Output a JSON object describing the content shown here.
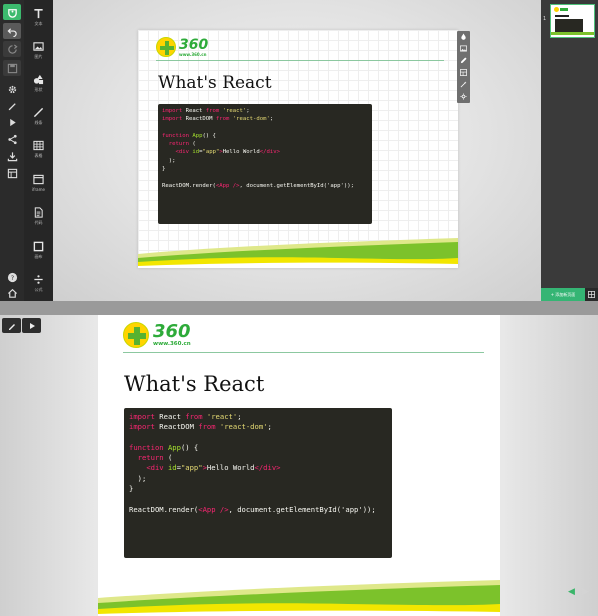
{
  "left_rail": {
    "items": [
      "home-logo",
      "undo",
      "redo",
      "save",
      "settings",
      "pen",
      "play",
      "share",
      "download",
      "template"
    ],
    "bottom": [
      "help",
      "home"
    ]
  },
  "tools": [
    {
      "name": "text",
      "label": "文本"
    },
    {
      "name": "image",
      "label": "图片"
    },
    {
      "name": "shape",
      "label": "形状"
    },
    {
      "name": "line",
      "label": "线条"
    },
    {
      "name": "table",
      "label": "表格"
    },
    {
      "name": "iframe",
      "label": "iframe"
    },
    {
      "name": "code",
      "label": "代码"
    },
    {
      "name": "canvas",
      "label": "画布"
    },
    {
      "name": "formula",
      "label": "公式"
    }
  ],
  "slide": {
    "logo_number": "360",
    "logo_url": "www.360.cn",
    "title": "What's React",
    "code_lines": [
      [
        [
          "kw",
          "import"
        ],
        [
          "plain",
          " React "
        ],
        [
          "kw",
          "from"
        ],
        [
          "plain",
          " "
        ],
        [
          "str",
          "'react'"
        ],
        [
          "plain",
          ";"
        ]
      ],
      [
        [
          "kw",
          "import"
        ],
        [
          "plain",
          " ReactDOM "
        ],
        [
          "kw",
          "from"
        ],
        [
          "plain",
          " "
        ],
        [
          "str",
          "'react-dom'"
        ],
        [
          "plain",
          ";"
        ]
      ],
      [
        [
          "plain",
          ""
        ]
      ],
      [
        [
          "kw",
          "function"
        ],
        [
          "plain",
          " "
        ],
        [
          "fn",
          "App"
        ],
        [
          "plain",
          "() {"
        ]
      ],
      [
        [
          "plain",
          "  "
        ],
        [
          "kw",
          "return"
        ],
        [
          "plain",
          " ("
        ]
      ],
      [
        [
          "plain",
          "    "
        ],
        [
          "tag",
          "<div"
        ],
        [
          "plain",
          " "
        ],
        [
          "attr",
          "id"
        ],
        [
          "plain",
          "="
        ],
        [
          "str",
          "\"app\""
        ],
        [
          "tag",
          ">"
        ],
        [
          "plain",
          "Hello World"
        ],
        [
          "tag",
          "</div>"
        ]
      ],
      [
        [
          "plain",
          "  );"
        ]
      ],
      [
        [
          "plain",
          "}"
        ]
      ],
      [
        [
          "plain",
          ""
        ]
      ],
      [
        [
          "plain",
          "ReactDOM.render("
        ],
        [
          "tag",
          "<App />"
        ],
        [
          "plain",
          ", document.getElementById('app'));"
        ]
      ]
    ]
  },
  "right_panel": {
    "slide_number": "1",
    "add_page_label": "+ 添加新页面"
  },
  "colors": {
    "accent_green": "#35b574",
    "logo_green": "#2eab3a",
    "code_bg": "#282822",
    "wave_green": "#7cc22b",
    "wave_yellow": "#f2e600"
  }
}
